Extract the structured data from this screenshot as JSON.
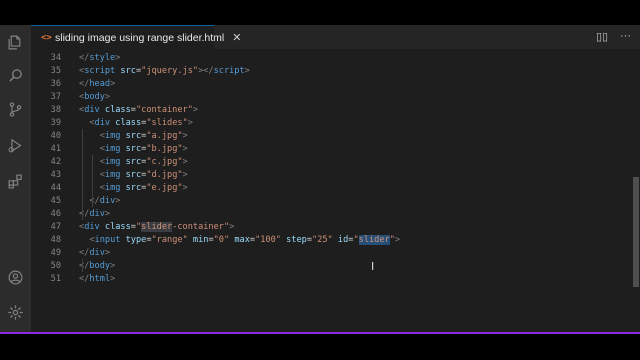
{
  "window": {
    "accent": "#0e639c",
    "bottom_bar_color": "#8a2be2"
  },
  "activity_bar": {
    "items": [
      {
        "name": "explorer-icon"
      },
      {
        "name": "search-icon"
      },
      {
        "name": "source-control-icon"
      },
      {
        "name": "run-debug-icon"
      },
      {
        "name": "extensions-icon"
      }
    ],
    "bottom": [
      {
        "name": "account-icon"
      },
      {
        "name": "settings-gear-icon"
      }
    ]
  },
  "tab": {
    "icon": "<>",
    "label": "sliding image using range slider.html",
    "close": "✕"
  },
  "tab_actions": {
    "split": "▯▯",
    "more": "···"
  },
  "code_lines": [
    {
      "n": "34",
      "segments": [
        {
          "c": "t",
          "v": "</"
        },
        {
          "c": "tag",
          "v": "style"
        },
        {
          "c": "t",
          "v": ">"
        }
      ]
    },
    {
      "n": "35",
      "segments": [
        {
          "c": "t",
          "v": "<"
        },
        {
          "c": "tag",
          "v": "script"
        },
        {
          "c": "txt",
          "v": " "
        },
        {
          "c": "attr",
          "v": "src"
        },
        {
          "c": "txt",
          "v": "="
        },
        {
          "c": "str",
          "v": "\"jquery.js\""
        },
        {
          "c": "t",
          "v": "></"
        },
        {
          "c": "tag",
          "v": "script"
        },
        {
          "c": "t",
          "v": ">"
        }
      ]
    },
    {
      "n": "36",
      "segments": [
        {
          "c": "t",
          "v": "</"
        },
        {
          "c": "tag",
          "v": "head"
        },
        {
          "c": "t",
          "v": ">"
        }
      ]
    },
    {
      "n": "37",
      "segments": [
        {
          "c": "t",
          "v": "<"
        },
        {
          "c": "tag",
          "v": "body"
        },
        {
          "c": "t",
          "v": ">"
        }
      ]
    },
    {
      "n": "38",
      "segments": [
        {
          "c": "t",
          "v": "<"
        },
        {
          "c": "tag",
          "v": "div"
        },
        {
          "c": "txt",
          "v": " "
        },
        {
          "c": "attr",
          "v": "class"
        },
        {
          "c": "txt",
          "v": "="
        },
        {
          "c": "str",
          "v": "\"container\""
        },
        {
          "c": "t",
          "v": ">"
        }
      ]
    },
    {
      "n": "39",
      "segments": [
        {
          "c": "txt",
          "v": "  "
        },
        {
          "c": "t",
          "v": "<"
        },
        {
          "c": "tag",
          "v": "div"
        },
        {
          "c": "txt",
          "v": " "
        },
        {
          "c": "attr",
          "v": "class"
        },
        {
          "c": "txt",
          "v": "="
        },
        {
          "c": "str",
          "v": "\"slides\""
        },
        {
          "c": "t",
          "v": ">"
        }
      ]
    },
    {
      "n": "40",
      "segments": [
        {
          "c": "txt",
          "v": "    "
        },
        {
          "c": "t",
          "v": "<"
        },
        {
          "c": "tag",
          "v": "img"
        },
        {
          "c": "txt",
          "v": " "
        },
        {
          "c": "attr",
          "v": "src"
        },
        {
          "c": "txt",
          "v": "="
        },
        {
          "c": "str",
          "v": "\"a.jpg\""
        },
        {
          "c": "t",
          "v": ">"
        }
      ]
    },
    {
      "n": "41",
      "segments": [
        {
          "c": "txt",
          "v": "    "
        },
        {
          "c": "t",
          "v": "<"
        },
        {
          "c": "tag",
          "v": "img"
        },
        {
          "c": "txt",
          "v": " "
        },
        {
          "c": "attr",
          "v": "src"
        },
        {
          "c": "txt",
          "v": "="
        },
        {
          "c": "str",
          "v": "\"b.jpg\""
        },
        {
          "c": "t",
          "v": ">"
        }
      ]
    },
    {
      "n": "42",
      "segments": [
        {
          "c": "txt",
          "v": "    "
        },
        {
          "c": "t",
          "v": "<"
        },
        {
          "c": "tag",
          "v": "img"
        },
        {
          "c": "txt",
          "v": " "
        },
        {
          "c": "attr",
          "v": "src"
        },
        {
          "c": "txt",
          "v": "="
        },
        {
          "c": "str",
          "v": "\"c.jpg\""
        },
        {
          "c": "t",
          "v": ">"
        }
      ]
    },
    {
      "n": "43",
      "segments": [
        {
          "c": "txt",
          "v": "    "
        },
        {
          "c": "t",
          "v": "<"
        },
        {
          "c": "tag",
          "v": "img"
        },
        {
          "c": "txt",
          "v": " "
        },
        {
          "c": "attr",
          "v": "src"
        },
        {
          "c": "txt",
          "v": "="
        },
        {
          "c": "str",
          "v": "\"d.jpg\""
        },
        {
          "c": "t",
          "v": ">"
        }
      ]
    },
    {
      "n": "44",
      "segments": [
        {
          "c": "txt",
          "v": "    "
        },
        {
          "c": "t",
          "v": "<"
        },
        {
          "c": "tag",
          "v": "img"
        },
        {
          "c": "txt",
          "v": " "
        },
        {
          "c": "attr",
          "v": "src"
        },
        {
          "c": "txt",
          "v": "="
        },
        {
          "c": "str",
          "v": "\"e.jpg\""
        },
        {
          "c": "t",
          "v": ">"
        }
      ]
    },
    {
      "n": "45",
      "segments": [
        {
          "c": "txt",
          "v": "  "
        },
        {
          "c": "t",
          "v": "</"
        },
        {
          "c": "tag",
          "v": "div"
        },
        {
          "c": "t",
          "v": ">"
        }
      ]
    },
    {
      "n": "46",
      "segments": [
        {
          "c": "t",
          "v": "</"
        },
        {
          "c": "tag",
          "v": "div"
        },
        {
          "c": "t",
          "v": ">"
        }
      ]
    },
    {
      "n": "47",
      "segments": [
        {
          "c": "t",
          "v": "<"
        },
        {
          "c": "tag",
          "v": "div"
        },
        {
          "c": "txt",
          "v": " "
        },
        {
          "c": "attr",
          "v": "class"
        },
        {
          "c": "txt",
          "v": "="
        },
        {
          "c": "str",
          "v": "\""
        },
        {
          "c": "str hl",
          "v": "slider"
        },
        {
          "c": "str",
          "v": "-container\""
        },
        {
          "c": "t",
          "v": ">"
        }
      ]
    },
    {
      "n": "48",
      "segments": [
        {
          "c": "txt",
          "v": "  "
        },
        {
          "c": "t",
          "v": "<"
        },
        {
          "c": "tag",
          "v": "input"
        },
        {
          "c": "txt",
          "v": " "
        },
        {
          "c": "attr",
          "v": "type"
        },
        {
          "c": "txt",
          "v": "="
        },
        {
          "c": "str",
          "v": "\"range\""
        },
        {
          "c": "txt",
          "v": " "
        },
        {
          "c": "attr",
          "v": "min"
        },
        {
          "c": "txt",
          "v": "="
        },
        {
          "c": "str",
          "v": "\"0\""
        },
        {
          "c": "txt",
          "v": " "
        },
        {
          "c": "attr",
          "v": "max"
        },
        {
          "c": "txt",
          "v": "="
        },
        {
          "c": "str",
          "v": "\"100\""
        },
        {
          "c": "txt",
          "v": " "
        },
        {
          "c": "attr",
          "v": "step"
        },
        {
          "c": "txt",
          "v": "="
        },
        {
          "c": "str",
          "v": "\"25\""
        },
        {
          "c": "txt",
          "v": " "
        },
        {
          "c": "attr",
          "v": "id"
        },
        {
          "c": "txt",
          "v": "="
        },
        {
          "c": "str",
          "v": "\""
        },
        {
          "c": "str sel",
          "v": "slider"
        },
        {
          "c": "str",
          "v": "\""
        },
        {
          "c": "t",
          "v": ">"
        }
      ]
    },
    {
      "n": "49",
      "segments": [
        {
          "c": "t",
          "v": "</"
        },
        {
          "c": "tag",
          "v": "div"
        },
        {
          "c": "t",
          "v": ">"
        }
      ]
    },
    {
      "n": "50",
      "segments": [
        {
          "c": "t",
          "v": "</"
        },
        {
          "c": "tag",
          "v": "body"
        },
        {
          "c": "t",
          "v": ">"
        }
      ]
    },
    {
      "n": "51",
      "segments": [
        {
          "c": "t",
          "v": "</"
        },
        {
          "c": "tag",
          "v": "html"
        },
        {
          "c": "t",
          "v": ">"
        }
      ]
    }
  ]
}
